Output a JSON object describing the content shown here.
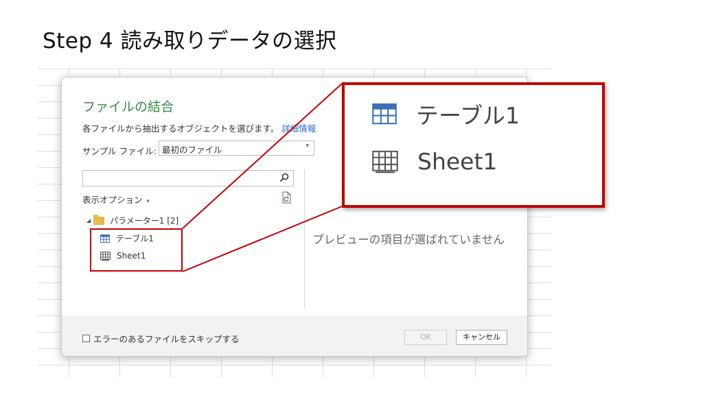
{
  "slide": {
    "title": "Step 4 読み取りデータの選択"
  },
  "dialog": {
    "title": "ファイルの結合",
    "description": "各ファイルから抽出するオブジェクトを選びます。",
    "details_link": "詳細情報",
    "sample_file_label": "サンプル ファイル:",
    "sample_file_value": "最初のファイル",
    "search_placeholder": "",
    "display_options_label": "表示オプション",
    "tree": {
      "folder_label": "パラメーター1 [2]",
      "items": [
        {
          "label": "テーブル1",
          "icon": "table-icon"
        },
        {
          "label": "Sheet1",
          "icon": "sheet-icon"
        }
      ]
    },
    "preview_message": "プレビューの項目が選ばれていません",
    "skip_errors_label": "エラーのあるファイルをスキップする",
    "ok_label": "OK",
    "cancel_label": "キャンセル"
  },
  "zoom": {
    "items": [
      {
        "label": "テーブル1",
        "icon": "table-icon"
      },
      {
        "label": "Sheet1",
        "icon": "sheet-icon"
      }
    ]
  },
  "colors": {
    "highlight": "#c00000",
    "title_green": "#3a8a4a",
    "link_blue": "#2a6bc2"
  }
}
